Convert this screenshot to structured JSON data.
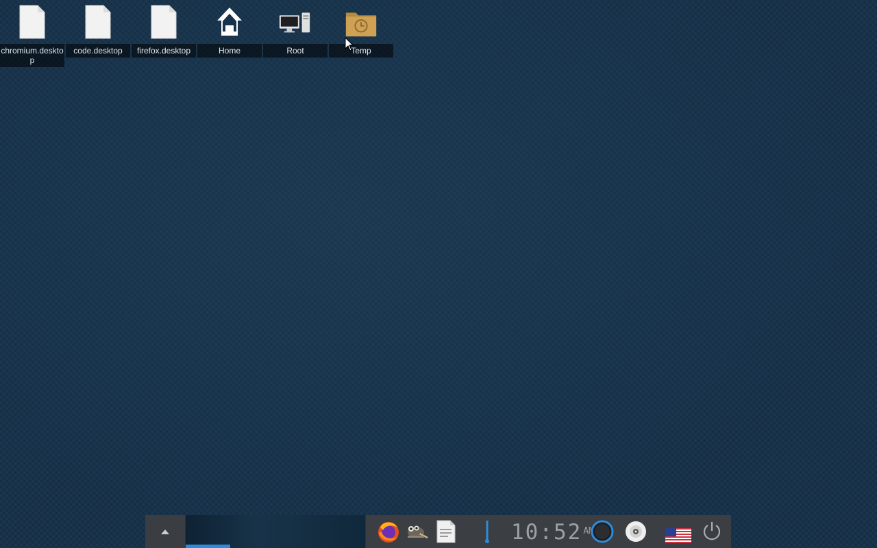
{
  "desktop": {
    "icons": [
      {
        "label": "chromium.desktop",
        "icon": "file-icon"
      },
      {
        "label": "code.desktop",
        "icon": "file-icon"
      },
      {
        "label": "firefox.desktop",
        "icon": "file-icon"
      },
      {
        "label": "Home",
        "icon": "home-icon"
      },
      {
        "label": "Root",
        "icon": "computer-icon"
      },
      {
        "label": "Temp",
        "icon": "folder-clock-icon"
      }
    ]
  },
  "panel": {
    "toggle_icon": "chevron-up-icon",
    "launchers": [
      "firefox-icon",
      "gimp-icon",
      "text-editor-icon"
    ],
    "clock": {
      "time": "10:52",
      "ampm": "AM"
    },
    "tray": [
      "volume-icon",
      "network-icon",
      "optical-disc-icon",
      "us-flag-icon",
      "power-icon"
    ]
  },
  "colors": {
    "desktop_background": "#17324a",
    "panel_background": "#2f3236",
    "task_indicator": "#2f8bd8",
    "folder": "#c89b4c"
  }
}
